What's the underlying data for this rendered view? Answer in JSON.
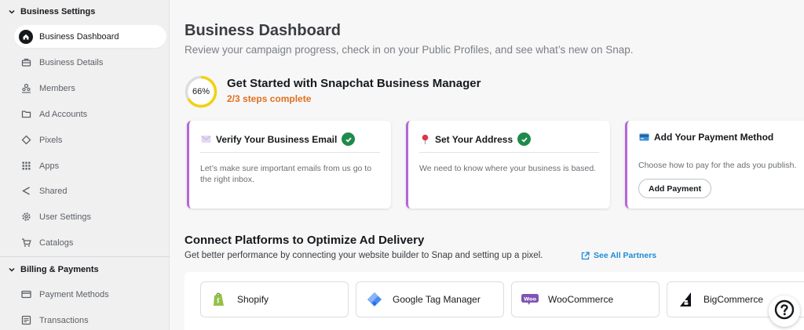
{
  "sidebar": {
    "sections": [
      {
        "title": "Business Settings",
        "items": [
          {
            "label": "Business Dashboard",
            "icon": "home-icon",
            "active": true
          },
          {
            "label": "Business Details",
            "icon": "briefcase-icon"
          },
          {
            "label": "Members",
            "icon": "members-icon"
          },
          {
            "label": "Ad Accounts",
            "icon": "folder-icon"
          },
          {
            "label": "Pixels",
            "icon": "diamond-icon"
          },
          {
            "label": "Apps",
            "icon": "grid-icon"
          },
          {
            "label": "Shared",
            "icon": "share-icon"
          },
          {
            "label": "User Settings",
            "icon": "gear-icon"
          },
          {
            "label": "Catalogs",
            "icon": "cart-icon"
          }
        ]
      },
      {
        "title": "Billing & Payments",
        "items": [
          {
            "label": "Payment Methods",
            "icon": "credit-card-icon"
          },
          {
            "label": "Transactions",
            "icon": "receipt-icon"
          }
        ]
      }
    ]
  },
  "header": {
    "title": "Business Dashboard",
    "subtitle": "Review your campaign progress, check in on your Public Profiles, and see what’s new on Snap."
  },
  "get_started": {
    "progress_label": "66%",
    "progress_fraction": 0.6667,
    "title": "Get Started with Snapchat Business Manager",
    "steps_text": "2/3 steps complete",
    "steps_color": "#e0701d",
    "cards": [
      {
        "title": "Verify Your Business Email",
        "icon": "envelope-icon",
        "completed": true,
        "body": "Let’s make sure important emails from us go to the right inbox."
      },
      {
        "title": "Set Your Address",
        "icon": "map-pin-icon",
        "completed": true,
        "body": "We need to know where your business is based."
      },
      {
        "title": "Add Your Payment Method",
        "icon": "credit-card-icon",
        "completed": false,
        "body": "Choose how to pay for the ads you publish.",
        "button": "Add Payment"
      }
    ]
  },
  "connect": {
    "title": "Connect Platforms to Optimize Ad Delivery",
    "subtitle": "Get better performance by connecting your website builder to Snap and setting up a pixel.",
    "link_label": "See All Partners",
    "platforms": [
      {
        "label": "Shopify",
        "icon": "shopify-icon"
      },
      {
        "label": "Google Tag Manager",
        "icon": "google-tag-manager-icon"
      },
      {
        "label": "WooCommerce",
        "icon": "woocommerce-icon"
      },
      {
        "label": "BigCommerce",
        "icon": "bigcommerce-icon"
      }
    ]
  },
  "colors": {
    "accent_border": "#b467d8",
    "check_green": "#1f8a4c",
    "progress_ring": "#f2d20f",
    "link_blue": "#1d8bd6"
  }
}
